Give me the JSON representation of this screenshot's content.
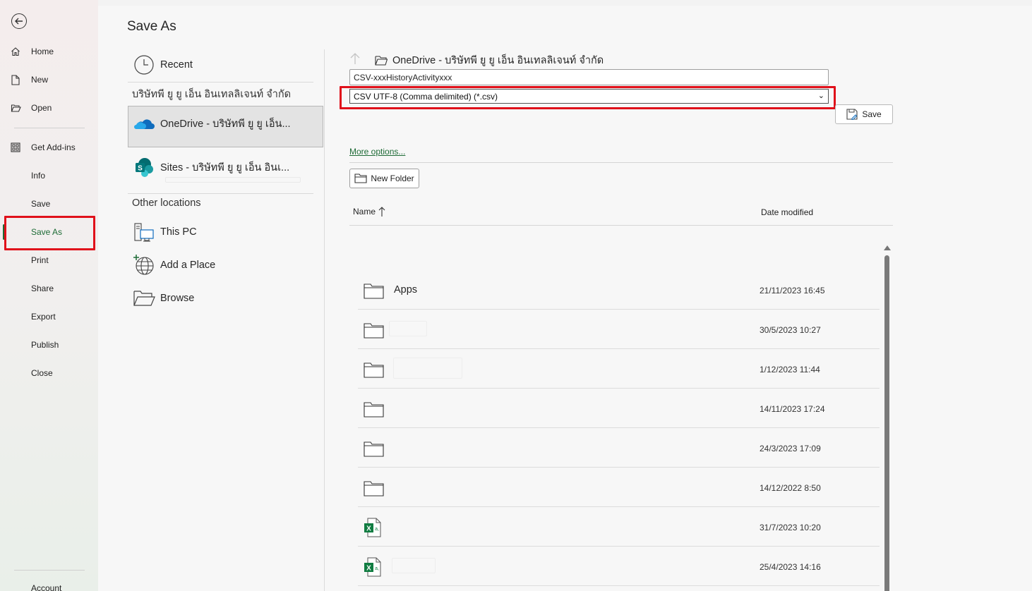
{
  "nav": {
    "items": [
      {
        "label": "Home",
        "icon": "home-icon"
      },
      {
        "label": "New",
        "icon": "new-document-icon"
      },
      {
        "label": "Open",
        "icon": "open-folder-icon"
      },
      {
        "label": "Get Add-ins",
        "icon": "add-ins-grid-icon"
      },
      {
        "label": "Info"
      },
      {
        "label": "Save"
      },
      {
        "label": "Save As",
        "active": true
      },
      {
        "label": "Print"
      },
      {
        "label": "Share"
      },
      {
        "label": "Export"
      },
      {
        "label": "Publish"
      },
      {
        "label": "Close"
      },
      {
        "label": "Account"
      }
    ]
  },
  "main": {
    "title": "Save As",
    "recent_label": "Recent",
    "org_label": "บริษัทพี ยู ยู เอ็น อินเทลลิเจนท์ จำกัด",
    "onedrive_label": "OneDrive - บริษัทพี ยู ยู เอ็น...",
    "sites_label": "Sites - บริษัทพี ยู ยู เอ็น อินเ...",
    "other_locations_label": "Other locations",
    "this_pc_label": "This PC",
    "add_place_label": "Add a Place",
    "browse_label": "Browse"
  },
  "panel": {
    "path": "OneDrive - บริษัทพี ยู ยู เอ็น อินเทลลิเจนท์ จำกัด",
    "filename": "CSV-xxxHistoryActivityxxx",
    "filetype": "CSV UTF-8 (Comma delimited) (*.csv)",
    "save_label": "Save",
    "more_options": "More options...",
    "new_folder": "New Folder",
    "col_name": "Name",
    "col_date": "Date modified",
    "files": [
      {
        "name": "Apps",
        "date": "21/11/2023 16:45",
        "type": "folder"
      },
      {
        "name": "",
        "date": "30/5/2023 10:27",
        "type": "folder"
      },
      {
        "name": "",
        "date": "1/12/2023 11:44",
        "type": "folder"
      },
      {
        "name": "",
        "date": "14/11/2023 17:24",
        "type": "folder"
      },
      {
        "name": "",
        "date": "24/3/2023 17:09",
        "type": "folder"
      },
      {
        "name": "",
        "date": "14/12/2022 8:50",
        "type": "folder"
      },
      {
        "name": "",
        "date": "31/7/2023 10:20",
        "type": "excel"
      },
      {
        "name": "",
        "date": "25/4/2023 14:16",
        "type": "excel"
      }
    ]
  },
  "colors": {
    "accent": "#1e6b36",
    "highlight": "#e0101a"
  }
}
